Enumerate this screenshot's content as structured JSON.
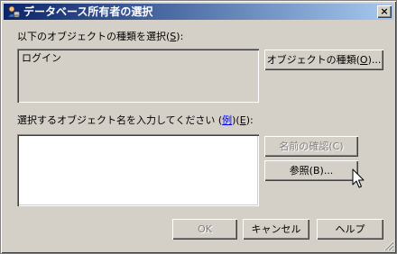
{
  "window": {
    "title": "データベース所有者の選択",
    "close_label": "×"
  },
  "object_types": {
    "label_prefix": "以下のオブジェクトの種類を選択(",
    "label_key": "S",
    "label_suffix": "):",
    "value": "ログイン",
    "button_prefix": "オブジェクトの種類(",
    "button_key": "O",
    "button_suffix": ")..."
  },
  "object_names": {
    "label_prefix": "選択するオブジェクト名を入力してください (",
    "example_link": "例",
    "label_mid": ")(",
    "label_key": "E",
    "label_suffix": "):",
    "value": ""
  },
  "buttons": {
    "check_names": "名前の確認(C)",
    "browse": "参照(B)...",
    "ok": "OK",
    "cancel": "キャンセル",
    "help": "ヘルプ"
  },
  "state": {
    "check_names_enabled": false,
    "ok_enabled": false
  }
}
